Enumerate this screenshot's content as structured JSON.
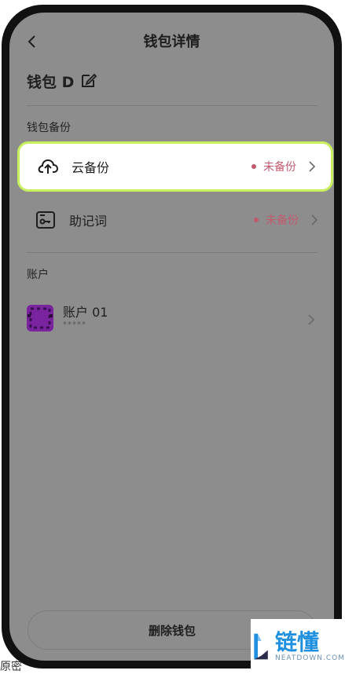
{
  "header": {
    "title": "钱包详情"
  },
  "wallet": {
    "name": "钱包 D"
  },
  "backup_section": {
    "title": "钱包备份",
    "items": [
      {
        "label": "云备份",
        "status": "未备份"
      },
      {
        "label": "助记词",
        "status": "未备份"
      }
    ]
  },
  "account_section": {
    "title": "账户",
    "account": {
      "name": "账户 01",
      "subtitle": "*****"
    }
  },
  "actions": {
    "delete_label": "删除钱包"
  },
  "outer_text": "原密",
  "watermark": {
    "main": "链懂",
    "sub": "NEATDOWN.COM"
  }
}
